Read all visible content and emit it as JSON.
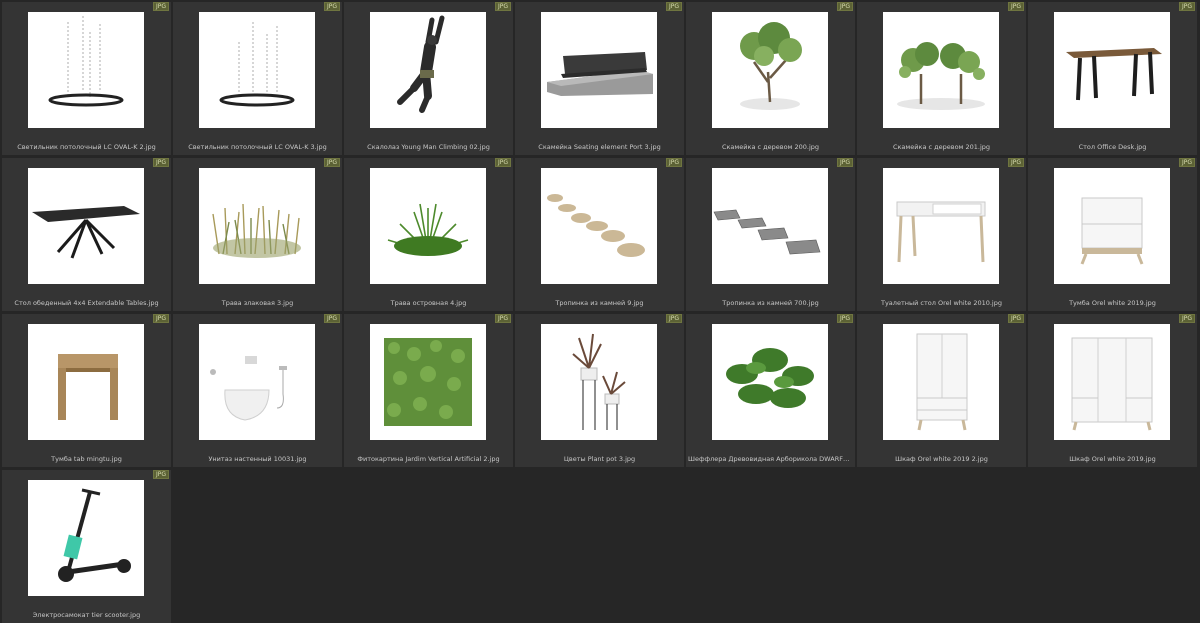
{
  "badge": "JPG",
  "files": [
    {
      "name": "Светильник потолочный LC OVAL-K 2.jpg",
      "icon": "pendant-lamp-icon"
    },
    {
      "name": "Светильник потолочный LC OVAL-K 3.jpg",
      "icon": "pendant-lamp-icon"
    },
    {
      "name": "Скалолаз Young Man Climbing 02.jpg",
      "icon": "climber-icon"
    },
    {
      "name": "Скамейка Seating element Port 3.jpg",
      "icon": "bench-icon"
    },
    {
      "name": "Скамейка с деревом 200.jpg",
      "icon": "tree-bench-icon"
    },
    {
      "name": "Скамейка с деревом 201.jpg",
      "icon": "two-trees-bench-icon"
    },
    {
      "name": "Стол Office Desk.jpg",
      "icon": "desk-icon"
    },
    {
      "name": "Стол обеденный 4x4 Extendable Tables.jpg",
      "icon": "dining-table-icon"
    },
    {
      "name": "Трава злаковая 3.jpg",
      "icon": "ornamental-grass-icon"
    },
    {
      "name": "Трава островная 4.jpg",
      "icon": "grass-tuft-icon"
    },
    {
      "name": "Тропинка из камней 9.jpg",
      "icon": "stone-path-icon"
    },
    {
      "name": "Тропинка из камней 700.jpg",
      "icon": "paver-path-icon"
    },
    {
      "name": "Туалетный стол Orel white 2010.jpg",
      "icon": "vanity-table-icon"
    },
    {
      "name": "Тумба Orel white 2019.jpg",
      "icon": "nightstand-icon"
    },
    {
      "name": "Тумба tab mingtu.jpg",
      "icon": "wood-console-icon"
    },
    {
      "name": "Унитаз настенный 10031.jpg",
      "icon": "wall-toilet-icon"
    },
    {
      "name": "Фитокартина Jardim Vertical Artificial 2.jpg",
      "icon": "green-wall-icon"
    },
    {
      "name": "Цветы Plant pot 3.jpg",
      "icon": "plant-pots-icon"
    },
    {
      "name": "Шеффлера Древовидная Арборикола DWARF1 UMBRELL...",
      "icon": "schefflera-icon"
    },
    {
      "name": "Шкаф Orel white 2019 2.jpg",
      "icon": "wardrobe-icon"
    },
    {
      "name": "Шкаф Orel white 2019.jpg",
      "icon": "wide-wardrobe-icon"
    },
    {
      "name": "Электросамокат tier scooter.jpg",
      "icon": "scooter-icon"
    }
  ]
}
